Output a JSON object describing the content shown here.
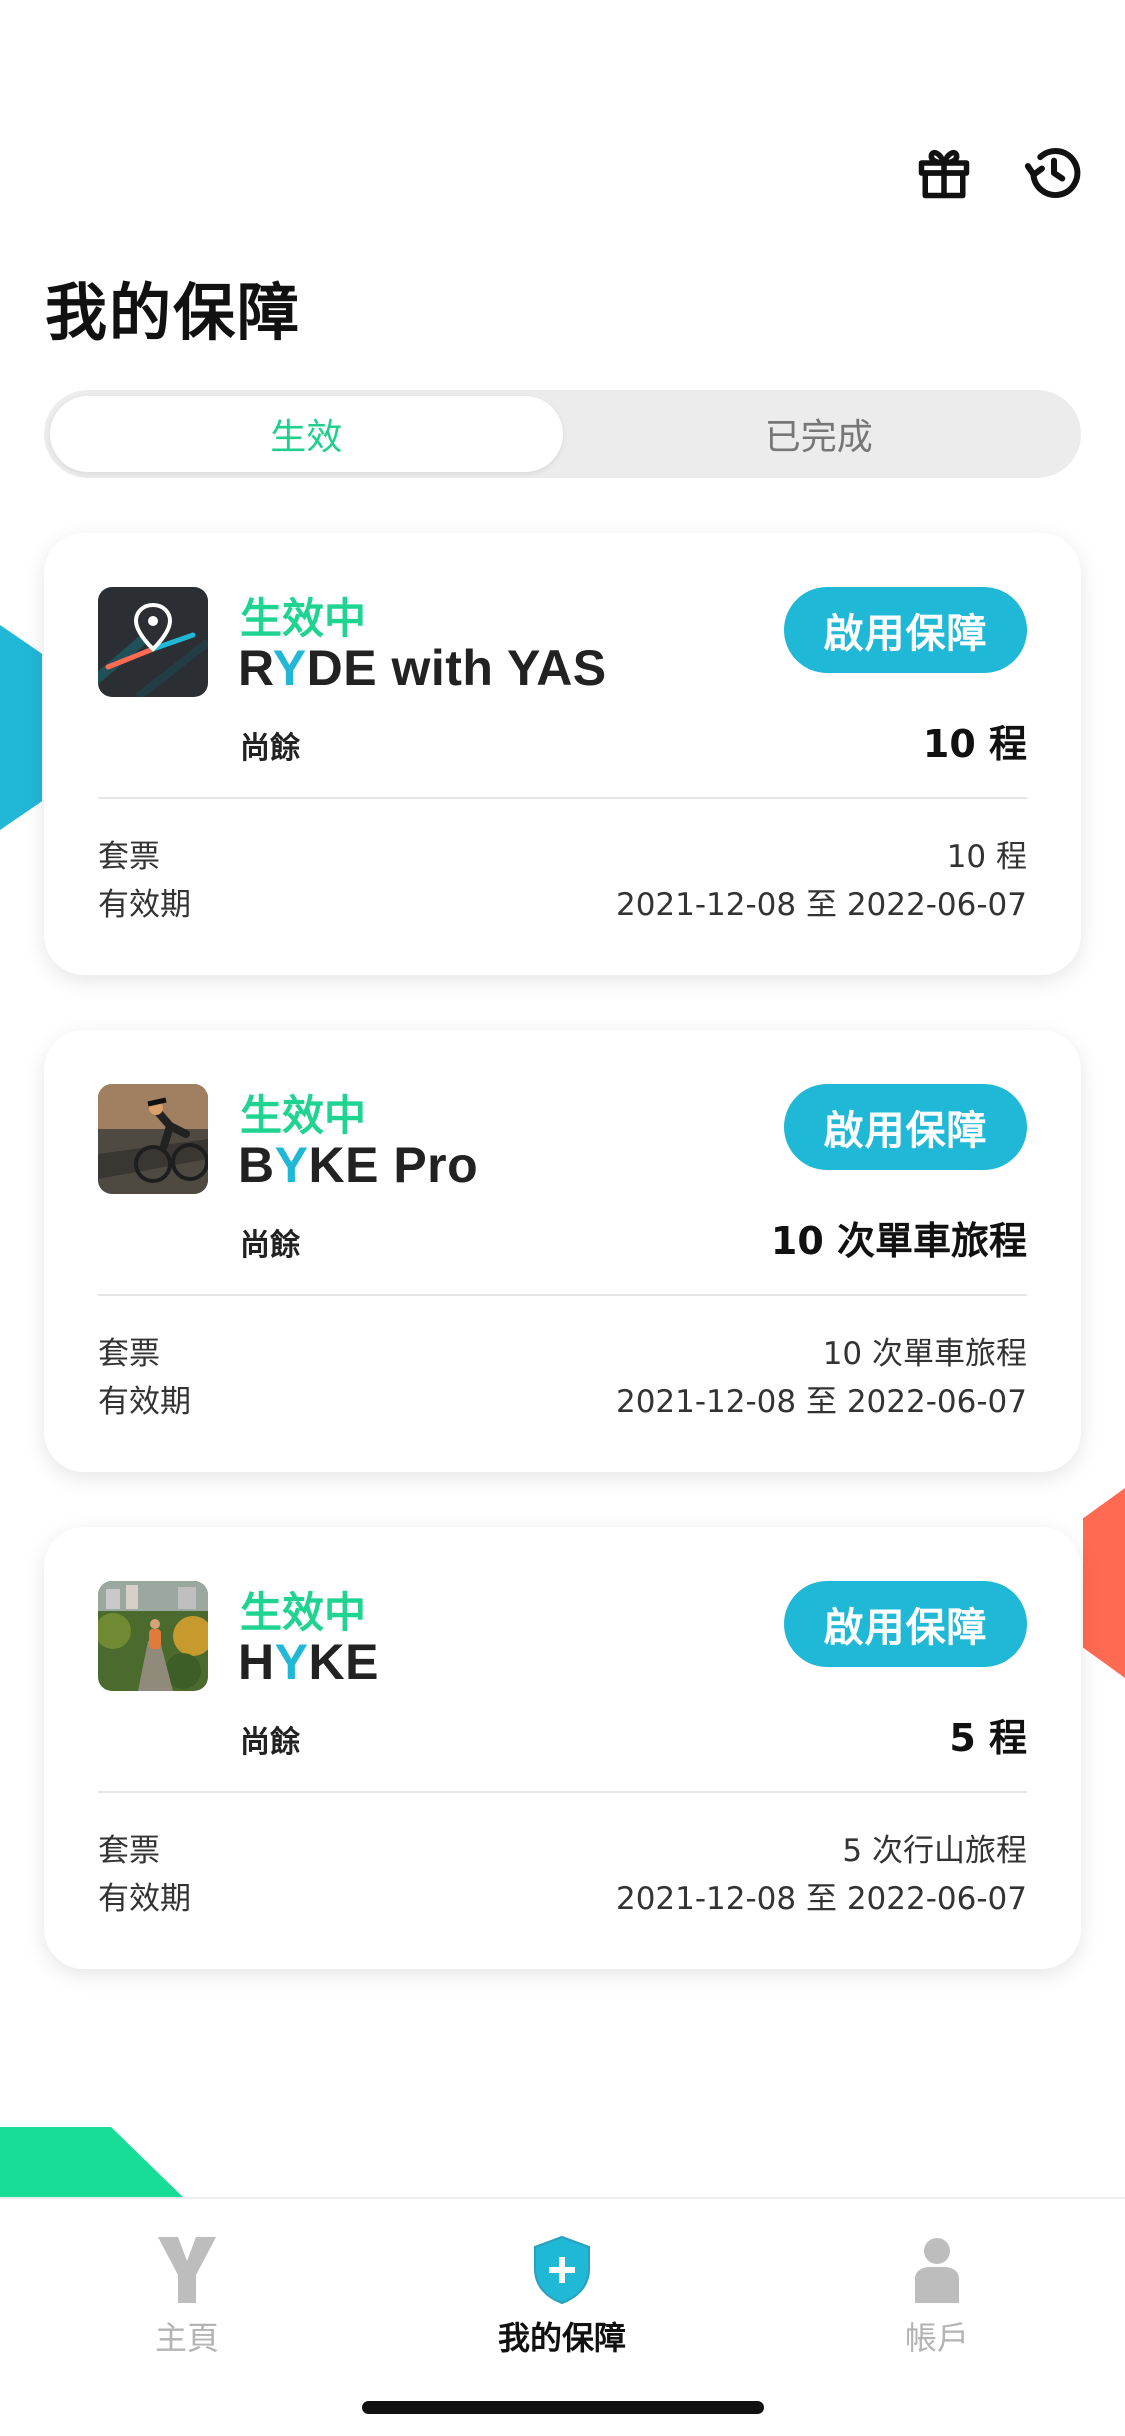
{
  "header": {
    "title": "我的保障",
    "gift_icon": "gift-icon",
    "history_icon": "history-icon"
  },
  "tabs": [
    {
      "label": "生效",
      "active": true
    },
    {
      "label": "已完成",
      "active": false
    }
  ],
  "cards": [
    {
      "status": "生效中",
      "name_prefix": "R",
      "name_y": "Y",
      "name_suffix": "DE with YAS",
      "button": "啟用保障",
      "remain_label": "尚餘",
      "remain_value": "10 程",
      "ticket_label": "套票",
      "ticket_value": "10 程",
      "validity_label": "有效期",
      "validity_value": "2021-12-08 至 2022-06-07",
      "thumb": "map-pin-icon"
    },
    {
      "status": "生效中",
      "name_prefix": "B",
      "name_y": "Y",
      "name_suffix": "KE Pro",
      "button": "啟用保障",
      "remain_label": "尚餘",
      "remain_value": "10 次單車旅程",
      "ticket_label": "套票",
      "ticket_value": "10 次單車旅程",
      "validity_label": "有效期",
      "validity_value": "2021-12-08 至 2022-06-07",
      "thumb": "cyclist-photo"
    },
    {
      "status": "生效中",
      "name_prefix": "H",
      "name_y": "Y",
      "name_suffix": "KE",
      "button": "啟用保障",
      "remain_label": "尚餘",
      "remain_value": "5 程",
      "ticket_label": "套票",
      "ticket_value": "5 次行山旅程",
      "validity_label": "有效期",
      "validity_value": "2021-12-08 至 2022-06-07",
      "thumb": "hiker-photo"
    }
  ],
  "nav": [
    {
      "label": "主頁",
      "icon": "y-logo-icon",
      "active": false
    },
    {
      "label": "我的保障",
      "icon": "shield-plus-icon",
      "active": true
    },
    {
      "label": "帳戶",
      "icon": "person-icon",
      "active": false
    }
  ],
  "colors": {
    "accent_green": "#1fd390",
    "accent_blue": "#1fb8d6",
    "accent_orange": "#ff6b52"
  }
}
